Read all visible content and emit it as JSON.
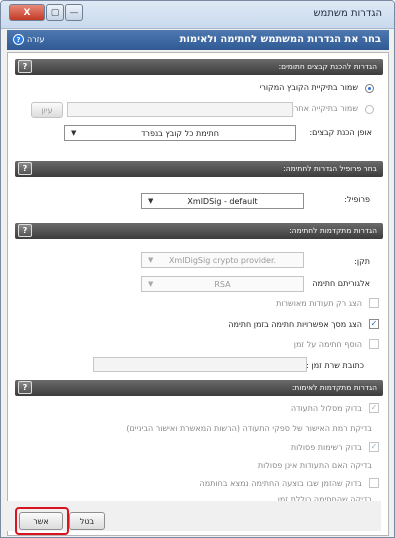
{
  "window": {
    "title": "הגדרות משתמש",
    "close_glyph": "X",
    "max_glyph": "▢",
    "min_glyph": "—"
  },
  "banner": {
    "title": "בחר את הגדרות המשתמש לחתימה ולאימות",
    "help_label": "עזרה",
    "help_glyph": "?"
  },
  "sections": {
    "files": "הגדרות להכנת קבצים חתומים:",
    "profile": "בחר פרופיל הגדרות לחתימה:",
    "advanced_sign": "הגדרות מתקדמות לחתימה:",
    "advanced_verify": "הגדרות מתקדמות לאימות:",
    "q_glyph": "?"
  },
  "files": {
    "save_original": "שמור בתיקיית הקובץ המקורי",
    "save_other": "שמור בתיקייה אחרת",
    "browse_label": "עיון",
    "prep_label": "אופן הכנת קבצים:",
    "prep_value": "חתימת כל קובץ בנפרד"
  },
  "profile": {
    "label": "פרופיל:",
    "value": "XmlDSig - default"
  },
  "advanced_sign": {
    "device_label": "תקן:",
    "device_value": "XmlDigSig crypto provider.",
    "algo_label": "אלגוריתם חתימה",
    "algo_value": "RSA",
    "only_approved": "הצג רק תעודות מאושרות",
    "show_options": "הצג מסך אפשרויות חתימה בזמן חתימה",
    "add_timestamp": "הוסף חתימה על זמן",
    "ts_server_label": "כתובת שרת זמן :"
  },
  "advanced_verify": {
    "check_path": "בדוק מסלול התעודה",
    "trust_level": "בדיקת רמת האישור של ספקי התעודה (הרשות המאשרת ואישור הביניים)",
    "check_crl": "בדוק רשימות פסולות",
    "crl_desc": "בדיקה האם התעודות אינן פסולות",
    "check_time": "בדוק שהזמן שבו בוצעה החתימה נמצא בחותמה",
    "time_desc": "בדיקה שהחתימה כוללת זמן"
  },
  "footer": {
    "ok_label": "אשר",
    "cancel_label": "בטל"
  },
  "colors": {
    "banner": "#2f5a94",
    "section": "#4a4a4a",
    "highlight": "#d7141f"
  }
}
